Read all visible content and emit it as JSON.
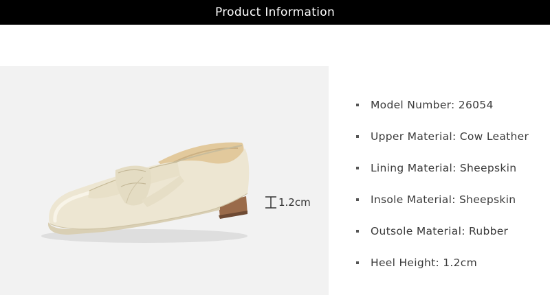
{
  "header": {
    "title": "Product Information"
  },
  "product_image": {
    "icon": "loafer-shoe-photo"
  },
  "heel_marker": {
    "label": "1.2cm",
    "icon": "height-indicator-icon"
  },
  "specs": [
    {
      "text": "Model Number: 26054"
    },
    {
      "text": "Upper Material: Cow Leather"
    },
    {
      "text": "Lining Material: Sheepskin"
    },
    {
      "text": "Insole Material: Sheepskin"
    },
    {
      "text": "Outsole Material: Rubber"
    },
    {
      "text": "Heel Height: 1.2cm"
    }
  ],
  "colors": {
    "header_bg": "#000000",
    "header_text": "#ffffff",
    "photo_bg": "#f2f2f2",
    "leather": "#ede6d2",
    "heel": "#9a6b4a"
  }
}
